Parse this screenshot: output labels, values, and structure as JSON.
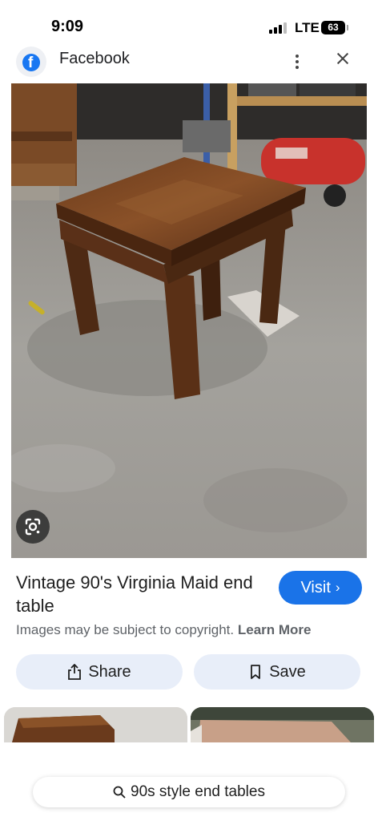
{
  "status_bar": {
    "time": "9:09",
    "network": "LTE",
    "battery": "63",
    "signal_icon": "signal-bars-icon"
  },
  "source": {
    "name": "Facebook",
    "icon": "facebook-logo-icon",
    "more_icon": "more-vertical-icon",
    "close_icon": "close-icon"
  },
  "image": {
    "lens_icon": "google-lens-icon"
  },
  "result": {
    "title": "Vintage 90's Virginia Maid end table",
    "visit_label": "Visit",
    "visit_icon": "chevron-right-icon",
    "copyright_text": "Images may be subject to copyright.",
    "learn_more_label": "Learn More"
  },
  "actions": {
    "share_label": "Share",
    "share_icon": "share-icon",
    "save_label": "Save",
    "save_icon": "bookmark-icon"
  },
  "search": {
    "query": "90s style end tables",
    "icon": "search-icon"
  },
  "colors": {
    "accent": "#1a73e8",
    "action_button_bg": "#e8eef9",
    "facebook_blue": "#1877f2"
  }
}
